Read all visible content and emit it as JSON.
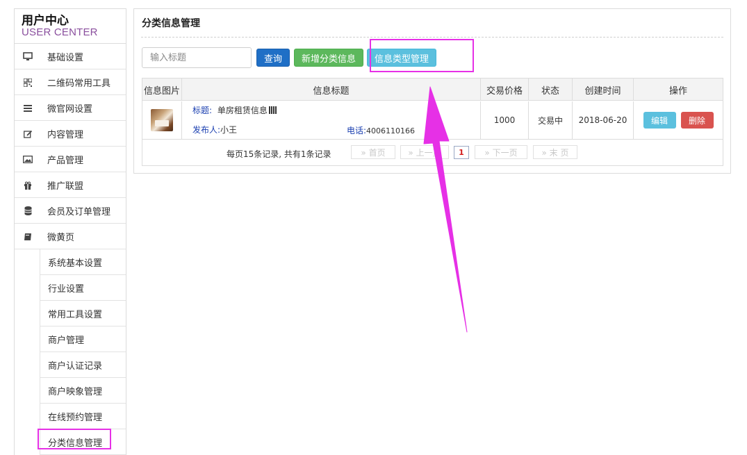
{
  "sidebar": {
    "title": "用户中心",
    "subtitle": "USER CENTER",
    "items": [
      {
        "label": "基础设置",
        "icon": "monitor-icon"
      },
      {
        "label": "二维码常用工具",
        "icon": "qrcode-icon"
      },
      {
        "label": "微官网设置",
        "icon": "list-icon"
      },
      {
        "label": "内容管理",
        "icon": "edit-icon"
      },
      {
        "label": "产品管理",
        "icon": "image-icon"
      },
      {
        "label": "推广联盟",
        "icon": "gift-icon"
      },
      {
        "label": "会员及订单管理",
        "icon": "database-icon"
      },
      {
        "label": "微黄页",
        "icon": "book-icon"
      }
    ],
    "subitems": [
      {
        "label": "系统基本设置"
      },
      {
        "label": "行业设置"
      },
      {
        "label": "常用工具设置"
      },
      {
        "label": "商户管理"
      },
      {
        "label": "商户认证记录"
      },
      {
        "label": "商户映象管理"
      },
      {
        "label": "在线预约管理"
      },
      {
        "label": "分类信息管理"
      }
    ]
  },
  "main": {
    "title": "分类信息管理",
    "search": {
      "placeholder": "输入标题",
      "value": ""
    },
    "buttons": {
      "query": "查询",
      "add": "新增分类信息",
      "type_manage": "信息类型管理"
    },
    "table": {
      "headers": [
        "信息图片",
        "信息标题",
        "交易价格",
        "状态",
        "创建时间",
        "操作"
      ],
      "rows": [
        {
          "title_label": "标题:",
          "title": "单房租赁信息",
          "publisher_label": "发布人:",
          "publisher": "小王",
          "phone_label": "电话:",
          "phone": "4006110166",
          "price": "1000",
          "status": "交易中",
          "created": "2018-06-20",
          "edit": "编辑",
          "delete": "删除"
        }
      ]
    },
    "pagination": {
      "info": "每页15条记录,   共有1条记录",
      "first": "» 首页",
      "prev": "» 上一页",
      "current": "1",
      "next": "» 下一页",
      "last": "» 末  页"
    }
  },
  "colors": {
    "highlight": "#e630e6",
    "query_btn": "#1f6fc6",
    "add_btn": "#5cb85c",
    "type_btn": "#5bc0de",
    "delete_btn": "#d9534f",
    "subtitle": "#8a4f9e"
  }
}
